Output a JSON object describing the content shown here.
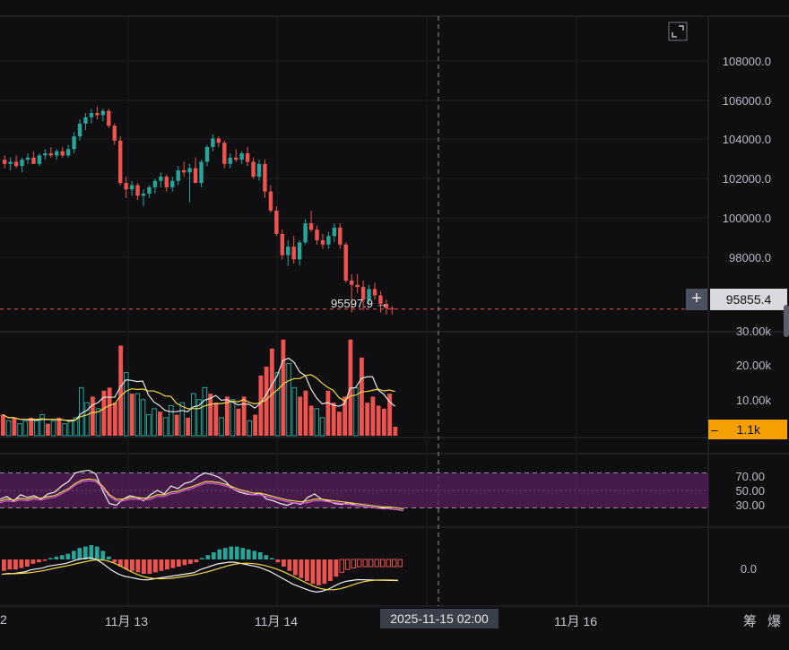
{
  "price_axis": {
    "labels": [
      "108000.0",
      "106000.0",
      "104000.0",
      "102000.0",
      "100000.0",
      "98000.0"
    ],
    "current_price": "95855.4",
    "last_low": "95597.9",
    "last_low_arrow": "→"
  },
  "volume_axis": {
    "labels": [
      "30.00k",
      "20.00k",
      "10.00k"
    ],
    "current_volume": "1.1k",
    "current_volume_dash": "–"
  },
  "rsi_axis": {
    "labels": [
      "70.00",
      "50.00",
      "30.00"
    ]
  },
  "macd_axis": {
    "labels": [
      "0.0"
    ]
  },
  "time_axis": {
    "left_edge": "2",
    "labels": [
      "11月 13",
      "11月 14",
      "11月 16"
    ],
    "cursor_date": "2025-11-15 02:00"
  },
  "toolbar": {
    "plus_label": "+",
    "chou_label": "筹",
    "bao_label": "爆"
  },
  "colors": {
    "up": "#26a69a",
    "down": "#ef5350",
    "bg": "#0f0f11",
    "rsi_band": "#5a1f5c",
    "accent": "#f5a000"
  },
  "chart_data": [
    {
      "type": "candlestick",
      "ylim": [
        95000,
        109500
      ],
      "candles": [
        [
          102900,
          103100,
          102500,
          102700
        ],
        [
          102700,
          103000,
          102400,
          102800
        ],
        [
          102800,
          103100,
          102500,
          102600
        ],
        [
          102600,
          103000,
          102300,
          102900
        ],
        [
          102900,
          103200,
          102700,
          103000
        ],
        [
          103000,
          103300,
          102800,
          102700
        ],
        [
          102700,
          103200,
          102600,
          103100
        ],
        [
          103100,
          103400,
          102900,
          103200
        ],
        [
          103200,
          103500,
          103000,
          103100
        ],
        [
          103100,
          103400,
          102900,
          103300
        ],
        [
          103300,
          103500,
          103000,
          103100
        ],
        [
          103100,
          103600,
          103000,
          103400
        ],
        [
          103400,
          104200,
          103200,
          104000
        ],
        [
          104000,
          104800,
          103800,
          104600
        ],
        [
          104600,
          105100,
          104300,
          104900
        ],
        [
          104900,
          105300,
          104600,
          105100
        ],
        [
          105100,
          105400,
          104800,
          105000
        ],
        [
          105000,
          105300,
          104700,
          105200
        ],
        [
          105200,
          105300,
          104400,
          104500
        ],
        [
          104500,
          104600,
          103600,
          103800
        ],
        [
          103800,
          104000,
          101700,
          101800
        ],
        [
          101800,
          102100,
          101100,
          101500
        ],
        [
          101500,
          101900,
          101200,
          101700
        ],
        [
          101700,
          101800,
          101000,
          101200
        ],
        [
          101200,
          101500,
          100700,
          101300
        ],
        [
          101300,
          101700,
          101100,
          101600
        ],
        [
          101600,
          102000,
          101300,
          101900
        ],
        [
          101900,
          102300,
          101600,
          102100
        ],
        [
          102100,
          102200,
          101400,
          101600
        ],
        [
          101600,
          102100,
          101400,
          101900
        ],
        [
          101900,
          102600,
          101700,
          102400
        ],
        [
          102400,
          102800,
          102100,
          102300
        ],
        [
          102300,
          102700,
          100900,
          102500
        ],
        [
          102500,
          103000,
          102300,
          101800
        ],
        [
          101800,
          102900,
          101600,
          102800
        ],
        [
          102800,
          103600,
          102600,
          103500
        ],
        [
          103500,
          104100,
          103300,
          103900
        ],
        [
          103900,
          104000,
          103500,
          103700
        ],
        [
          103700,
          103800,
          102500,
          102700
        ],
        [
          102700,
          103200,
          102500,
          103000
        ],
        [
          103000,
          103400,
          102800,
          102900
        ],
        [
          102900,
          103300,
          102700,
          103200
        ],
        [
          103200,
          103500,
          102600,
          102800
        ],
        [
          102800,
          103000,
          102000,
          102100
        ],
        [
          102100,
          102900,
          101900,
          102700
        ],
        [
          102700,
          102900,
          101100,
          101400
        ],
        [
          101400,
          101700,
          100400,
          100500
        ],
        [
          100500,
          100700,
          99300,
          99400
        ],
        [
          99400,
          99600,
          98200,
          98400
        ],
        [
          98400,
          99100,
          97900,
          98800
        ],
        [
          98800,
          99300,
          98000,
          98200
        ],
        [
          98200,
          99100,
          97900,
          99000
        ],
        [
          99000,
          100100,
          98900,
          99900
        ],
        [
          99900,
          100500,
          99500,
          99600
        ],
        [
          99600,
          99800,
          98900,
          99100
        ],
        [
          99100,
          99400,
          98700,
          98900
        ],
        [
          98900,
          99500,
          98700,
          99300
        ],
        [
          99300,
          99900,
          99000,
          99700
        ],
        [
          99700,
          99900,
          98700,
          98900
        ],
        [
          98900,
          99000,
          97100,
          97200
        ],
        [
          97200,
          97500,
          95700,
          97000
        ],
        [
          97000,
          97500,
          96600,
          96900
        ],
        [
          96900,
          97200,
          95800,
          96300
        ],
        [
          96300,
          97000,
          96100,
          96800
        ],
        [
          96800,
          97100,
          96300,
          96500
        ],
        [
          96500,
          96700,
          95700,
          96100
        ],
        [
          96100,
          96300,
          95600,
          95900
        ],
        [
          95900,
          96000,
          95600,
          95855
        ]
      ]
    },
    {
      "type": "bar",
      "series": [
        {
          "values": [
            7,
            5,
            6,
            4,
            5,
            6,
            5,
            7,
            4,
            5,
            6,
            4,
            5,
            6,
            16,
            11,
            13,
            9,
            15,
            16,
            11,
            30,
            21,
            14,
            14,
            12,
            7,
            9,
            8,
            6,
            10,
            7,
            11,
            6,
            14,
            12,
            16,
            14,
            11,
            6,
            13,
            12,
            9,
            13,
            5,
            7,
            20,
            23,
            29,
            21,
            32,
            24,
            16,
            13,
            15,
            10,
            9,
            6,
            15,
            11,
            8,
            13,
            32,
            16,
            26,
            11,
            13,
            10,
            9,
            14,
            3
          ]
        }
      ],
      "ylim": [
        0,
        34
      ]
    },
    {
      "type": "line",
      "series": [
        {
          "values": [
            40,
            43,
            38,
            45,
            42,
            44,
            40,
            46,
            48,
            55,
            60,
            70,
            72,
            73,
            69,
            50,
            35,
            33,
            40,
            44,
            42,
            38,
            45,
            50,
            46,
            55,
            52,
            58,
            60,
            66,
            70,
            68,
            65,
            60,
            52,
            48,
            46,
            45,
            47,
            40,
            38,
            35,
            33,
            36,
            34,
            42,
            46,
            40,
            38,
            35,
            34,
            36,
            33,
            32,
            31,
            30,
            30,
            29,
            28,
            27
          ]
        },
        {
          "values": [
            38,
            40,
            39,
            41,
            40,
            42,
            41,
            43,
            44,
            48,
            52,
            58,
            62,
            63,
            62,
            55,
            45,
            40,
            40,
            42,
            42,
            41,
            42,
            45,
            45,
            48,
            49,
            52,
            54,
            57,
            60,
            60,
            59,
            57,
            54,
            51,
            49,
            47,
            47,
            45,
            43,
            41,
            39,
            38,
            37,
            38,
            40,
            40,
            39,
            38,
            37,
            36,
            35,
            34,
            33,
            32,
            31,
            31,
            30,
            29
          ]
        }
      ],
      "ylim": [
        10,
        90
      ]
    },
    {
      "type": "bar",
      "series": [
        {
          "values": [
            -8,
            -7,
            -7,
            -6,
            -5,
            -3,
            -2,
            -1,
            1,
            2,
            3,
            4,
            6,
            8,
            9,
            10,
            9,
            6,
            2,
            -2,
            -5,
            -7,
            -8,
            -9,
            -10,
            -10,
            -9,
            -8,
            -7,
            -6,
            -5,
            -4,
            -3,
            -2,
            1,
            3,
            5,
            7,
            8,
            9,
            9,
            8,
            7,
            6,
            5,
            3,
            1,
            -2,
            -5,
            -8,
            -11,
            -13,
            -15,
            -17,
            -18,
            -17,
            -15,
            -12,
            -9,
            -7,
            -6,
            -5,
            -5,
            -5,
            -5,
            -5,
            -5,
            -5,
            -5
          ]
        }
      ],
      "ylim": [
        -30,
        20
      ]
    }
  ]
}
